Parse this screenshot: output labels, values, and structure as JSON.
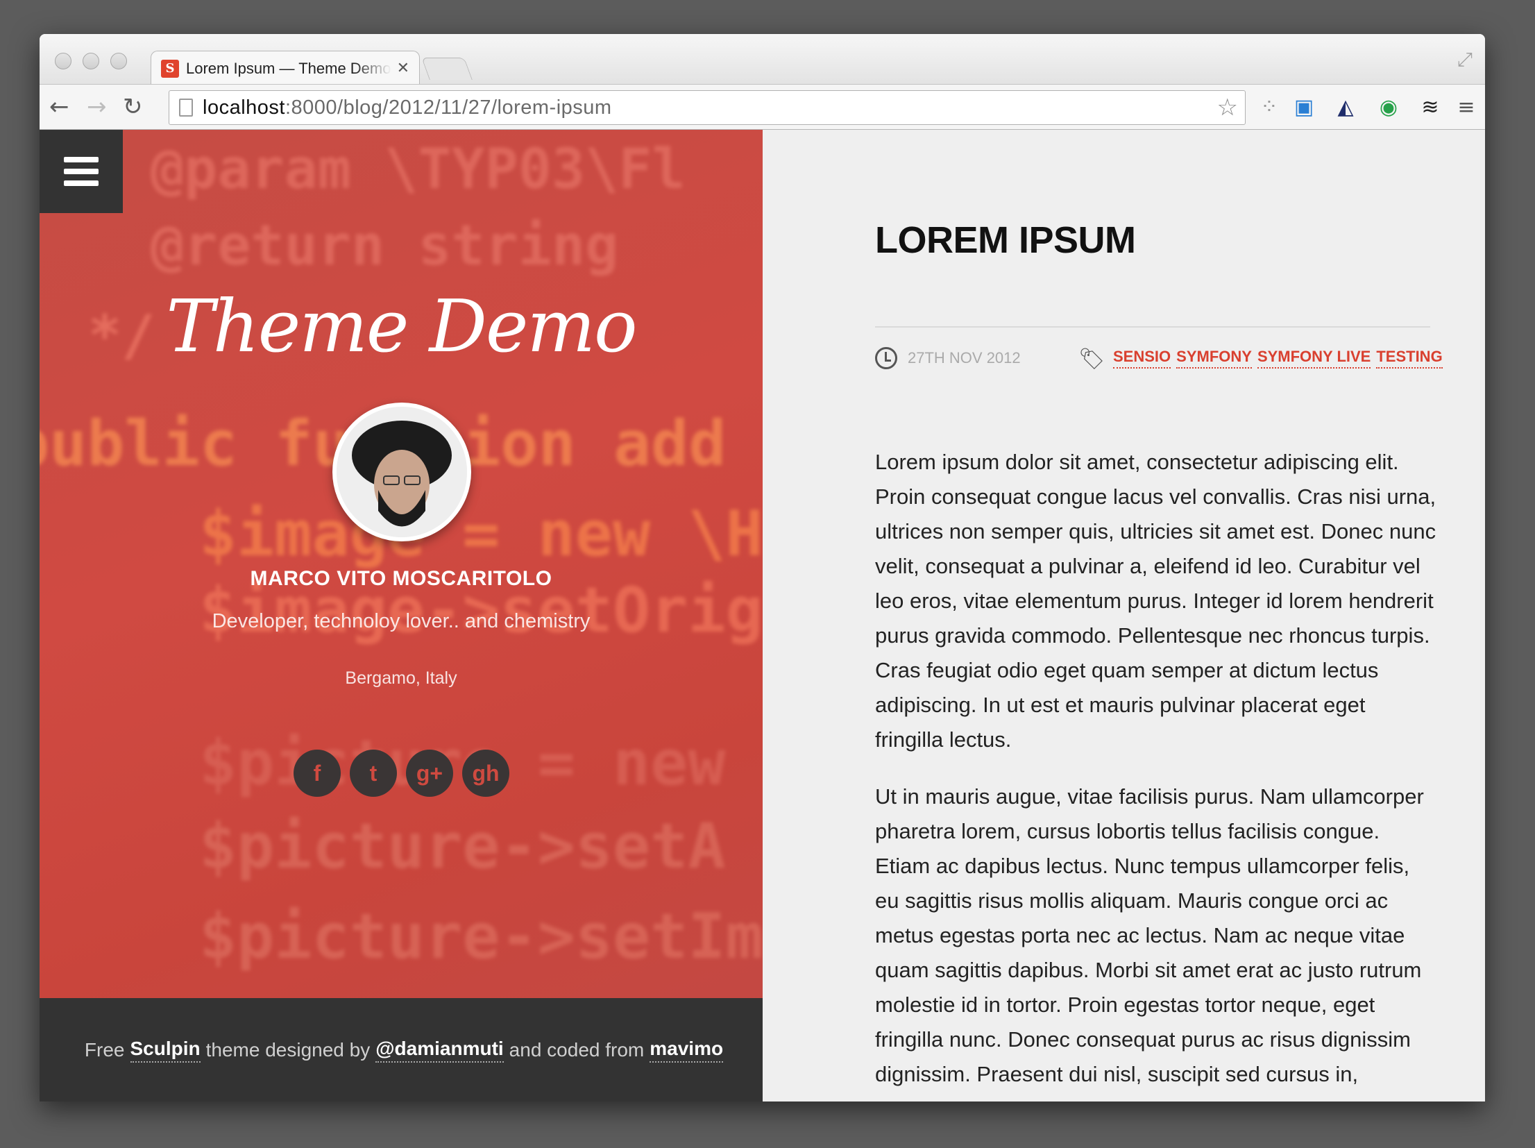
{
  "browser": {
    "tab_title": "Lorem Ipsum — Theme Demo",
    "favicon_letter": "S",
    "url_host": "localhost",
    "url_path": ":8000/blog/2012/11/27/lorem-ipsum",
    "close_glyph": "✕"
  },
  "sidebar": {
    "site_title": "Theme Demo",
    "author_name": "MARCO VITO MOSCARITOLO",
    "author_bio": "Developer, technoloy lover.. and chemistry",
    "author_location": "Bergamo, Italy",
    "social": [
      {
        "icon": "facebook-icon",
        "glyph": "f"
      },
      {
        "icon": "twitter-icon",
        "glyph": "t"
      },
      {
        "icon": "google-plus-icon",
        "glyph": "g+"
      },
      {
        "icon": "github-icon",
        "glyph": "gh"
      }
    ],
    "code_lines": [
      "@param \\TYP03\\Fl",
      "@return string",
      "*/",
      "public function add",
      "$image = new \\H",
      "$image->setOrig",
      "$picture = new",
      "$picture->setA",
      "$picture->setIm"
    ]
  },
  "footer": {
    "text_1": "Free",
    "link_1": "Sculpin",
    "text_2": "theme designed by",
    "link_2": "@damianmuti",
    "text_3": "and coded from",
    "link_3": "mavimo"
  },
  "post": {
    "title": "LOREM IPSUM",
    "date": "27TH NOV 2012",
    "tags": [
      "SENSIO",
      "SYMFONY",
      "SYMFONY LIVE",
      "TESTING"
    ],
    "paragraphs": [
      "Lorem ipsum dolor sit amet, consectetur adipiscing elit. Proin consequat congue lacus vel convallis. Cras nisi urna, ultrices non semper quis, ultricies sit amet est. Donec nunc velit, consequat a pulvinar a, eleifend id leo. Curabitur vel leo eros, vitae elementum purus. Integer id lorem hendrerit purus gravida commodo. Pellentesque nec rhoncus turpis. Cras feugiat odio eget quam semper at dictum lectus adipiscing. In ut est et mauris pulvinar placerat eget fringilla lectus.",
      "Ut in mauris augue, vitae facilisis purus. Nam ullamcorper pharetra lorem, cursus lobortis tellus facilisis congue. Etiam ac dapibus lectus. Nunc tempus ullamcorper felis, eu sagittis risus mollis aliquam. Mauris congue orci ac metus egestas porta nec ac lectus. Nam ac neque vitae quam sagittis dapibus. Morbi sit amet erat ac justo rutrum molestie id in tortor. Proin egestas tortor neque, eget fringilla nunc. Donec consequat purus ac risus dignissim dignissim. Praesent dui nisl, suscipit sed cursus in,"
    ]
  },
  "colors": {
    "accent": "#d9402f",
    "sidebar_bg": "#c9453c",
    "dark": "#333333",
    "content_bg": "#efefef"
  }
}
